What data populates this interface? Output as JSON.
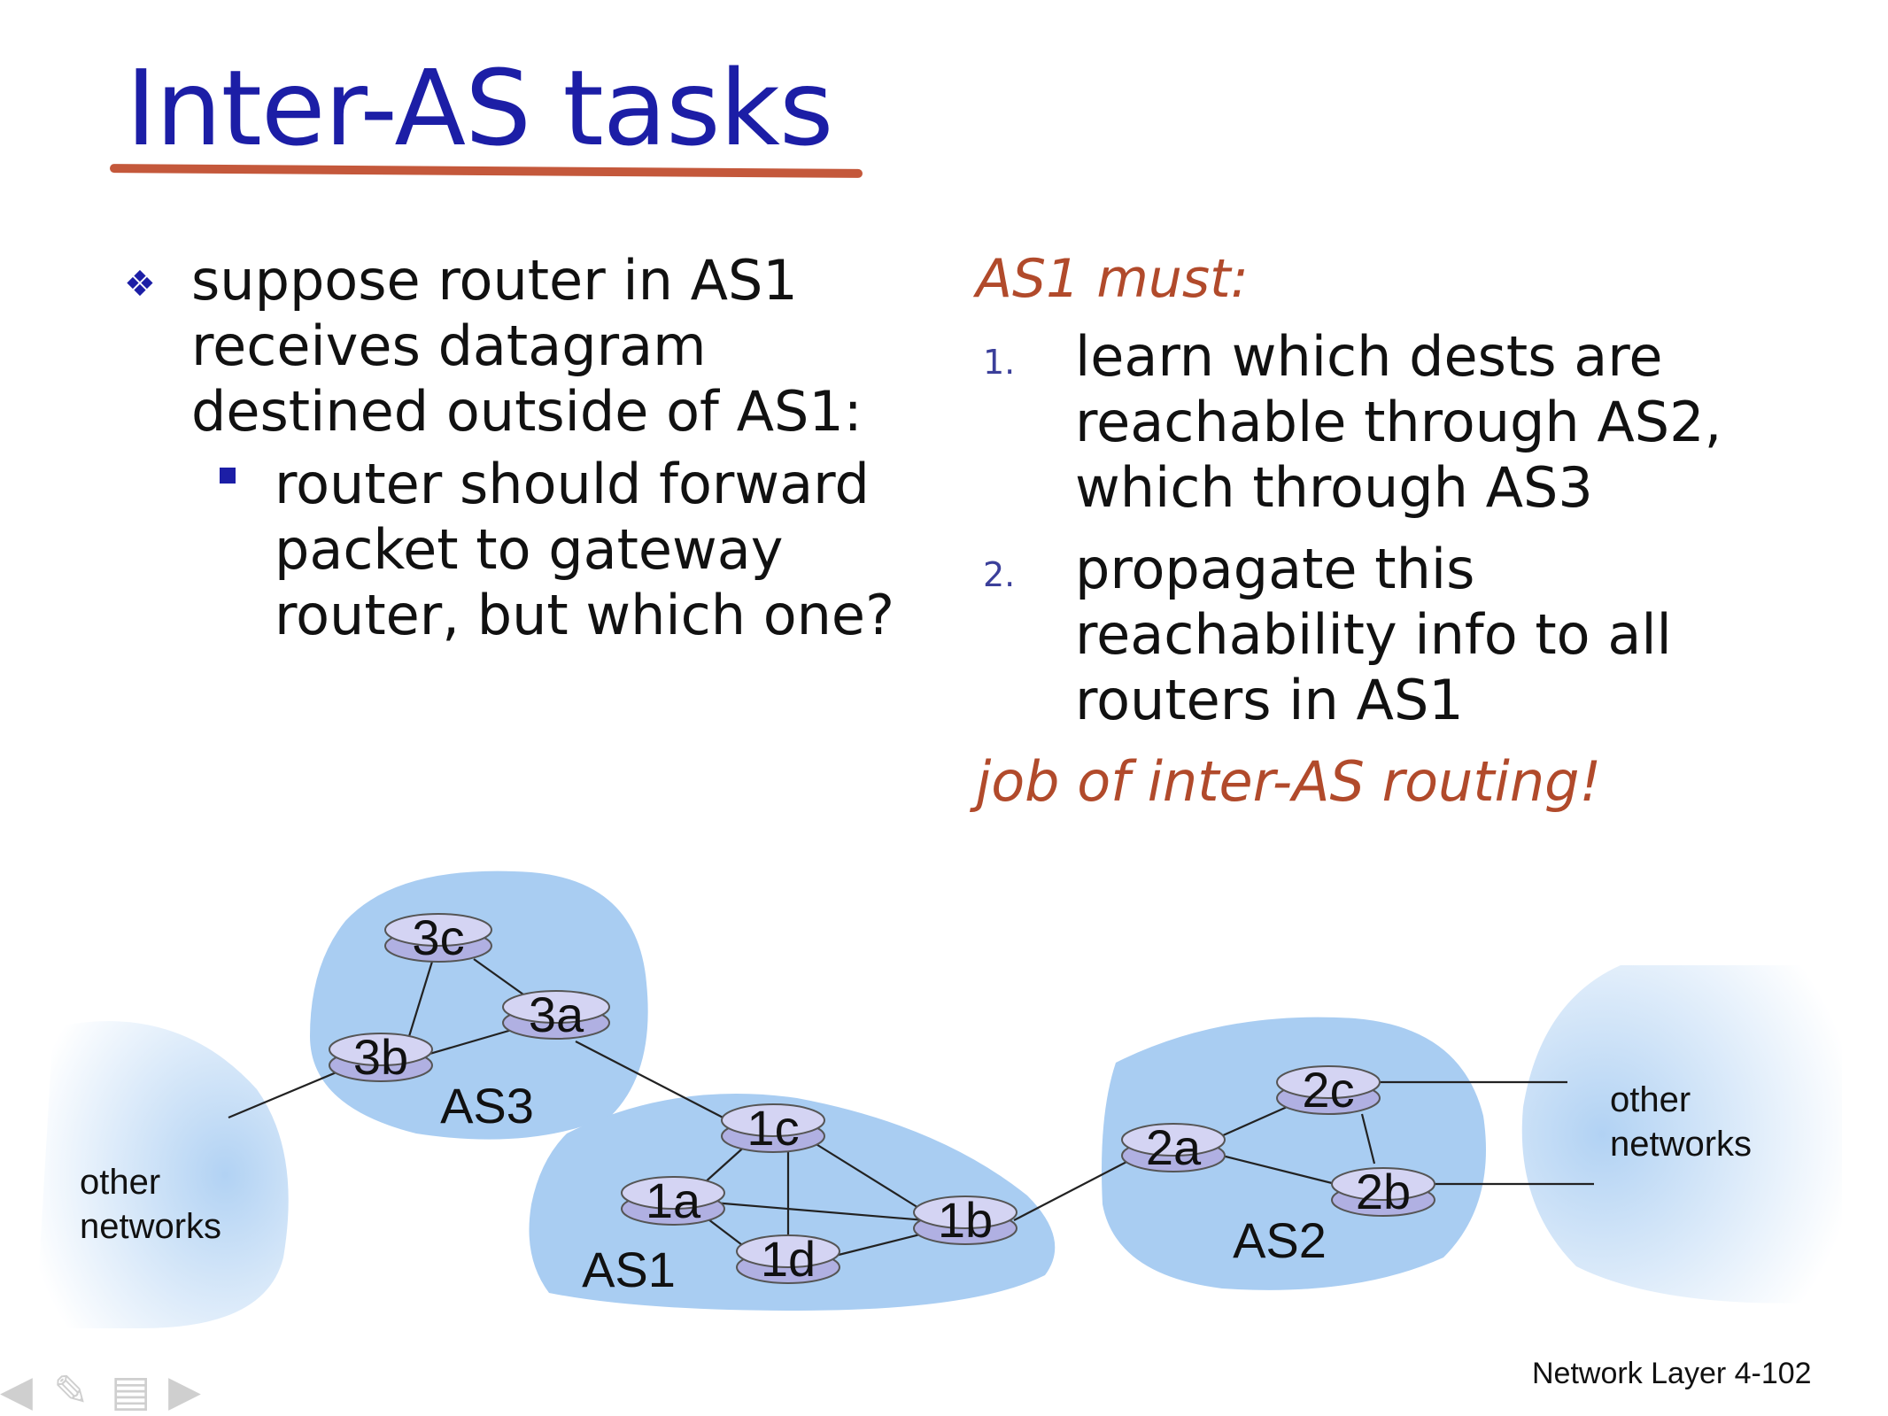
{
  "slide": {
    "title": "Inter-AS tasks",
    "bullet": {
      "lines": [
        "suppose router in AS1",
        "receives datagram",
        "destined outside of AS1:"
      ],
      "sub": [
        "router should forward",
        "packet to gateway",
        "router, but which one?"
      ]
    },
    "must_heading": "AS1 must:",
    "steps": [
      {
        "num": "1.",
        "lines": [
          "learn which dests are",
          "reachable through AS2,",
          "which through AS3"
        ]
      },
      {
        "num": "2.",
        "lines": [
          "propagate this",
          "reachability info to all",
          "routers in AS1"
        ]
      }
    ],
    "job": "job of inter-AS routing!",
    "footer": "Network Layer  4-102"
  },
  "diagram": {
    "routers": {
      "r3c": "3c",
      "r3a": "3a",
      "r3b": "3b",
      "r1c": "1c",
      "r1a": "1a",
      "r1b": "1b",
      "r1d": "1d",
      "r2a": "2a",
      "r2c": "2c",
      "r2b": "2b"
    },
    "as_labels": {
      "as3": "AS3",
      "as1": "AS1",
      "as2": "AS2"
    },
    "other_networks_left": [
      "other",
      "networks"
    ],
    "other_networks_right": [
      "other",
      "networks"
    ]
  },
  "colors": {
    "title": "#1c1ea6",
    "accent": "#b14a2b",
    "as_fill": "#a9cdf2",
    "router_fill": "#c9c9ee"
  }
}
